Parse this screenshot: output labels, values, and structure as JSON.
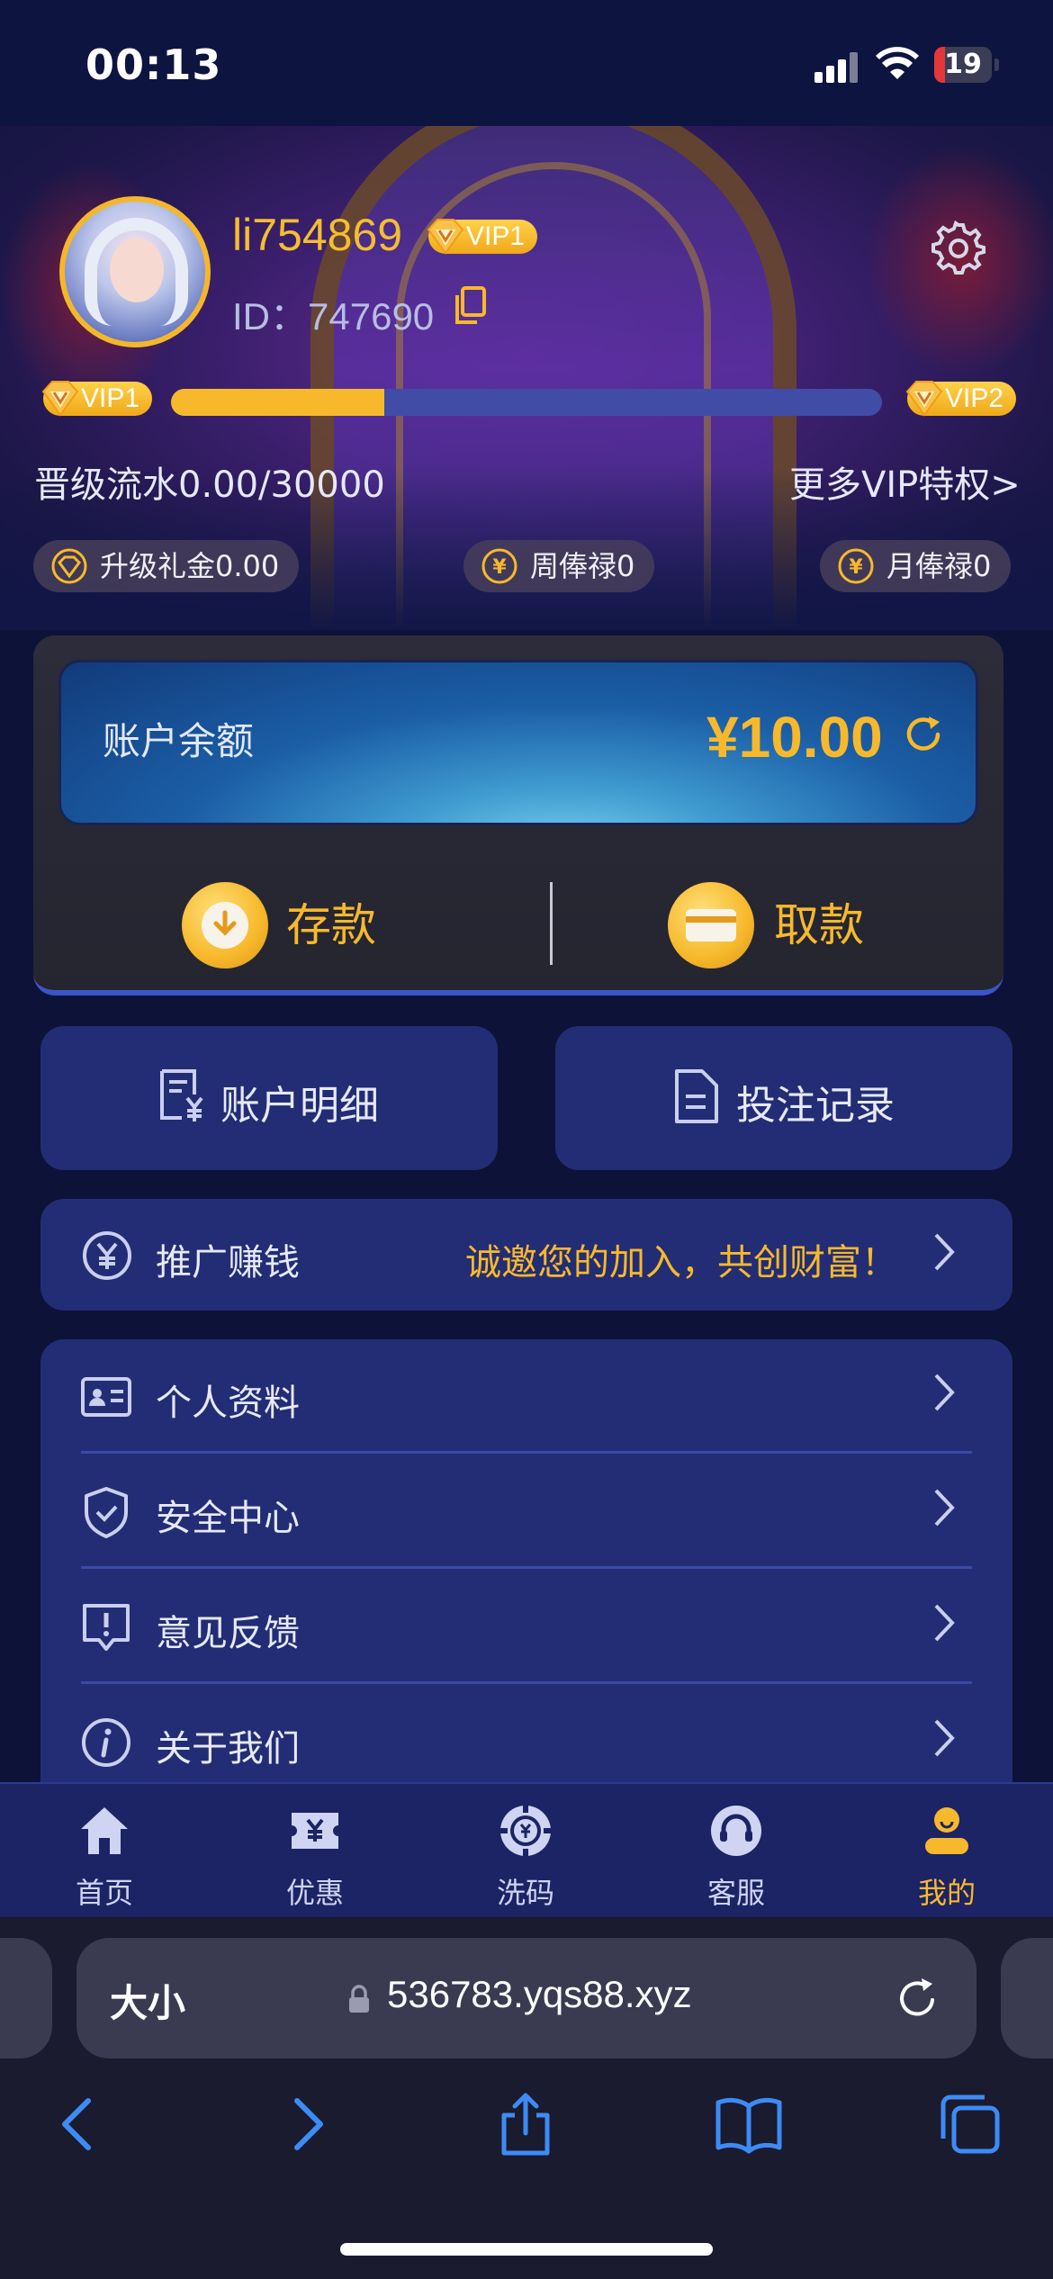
{
  "status_bar": {
    "time": "00:13",
    "battery": "19",
    "battery_level": 0.19
  },
  "profile": {
    "username": "li754869",
    "vip_badge": "VIP1",
    "id_label": "ID：",
    "id_value": "747690"
  },
  "vip_progress": {
    "current_level": "VIP1",
    "next_level": "VIP2",
    "progress": 0.3,
    "turnover_text": "晋级流水0.00/30000",
    "more_link": "更多VIP特权>"
  },
  "rewards": [
    {
      "label": "升级礼金0.00",
      "icon": "diamond-icon"
    },
    {
      "label": "周俸禄0",
      "icon": "yen-coin-icon"
    },
    {
      "label": "月俸禄0",
      "icon": "yen-coin-icon"
    }
  ],
  "wallet": {
    "balance_label": "账户余额",
    "balance_value": "¥10.00",
    "deposit_label": "存款",
    "withdraw_label": "取款"
  },
  "quick_actions": [
    {
      "label": "账户明细",
      "icon": "receipt-yen-icon"
    },
    {
      "label": "投注记录",
      "icon": "document-icon"
    }
  ],
  "promo": {
    "label": "推广赚钱",
    "slogan": "诚邀您的加入，共创财富！",
    "icon": "yen-circle-icon"
  },
  "menu": [
    {
      "label": "个人资料",
      "icon": "id-card-icon"
    },
    {
      "label": "安全中心",
      "icon": "shield-icon"
    },
    {
      "label": "意见反馈",
      "icon": "feedback-icon"
    },
    {
      "label": "关于我们",
      "icon": "info-icon"
    }
  ],
  "tabbar": [
    {
      "label": "首页",
      "icon": "home-icon",
      "active": false
    },
    {
      "label": "优惠",
      "icon": "ticket-icon",
      "active": false
    },
    {
      "label": "洗码",
      "icon": "chip-icon",
      "active": false
    },
    {
      "label": "客服",
      "icon": "headset-icon",
      "active": false
    },
    {
      "label": "我的",
      "icon": "user-icon",
      "active": true
    }
  ],
  "browser": {
    "text_size_label": "大小",
    "url": "536783.yqs88.xyz"
  },
  "colors": {
    "accent_gold": "#f7b92b",
    "card_blue": "#232d75",
    "background": "#0d1238"
  }
}
